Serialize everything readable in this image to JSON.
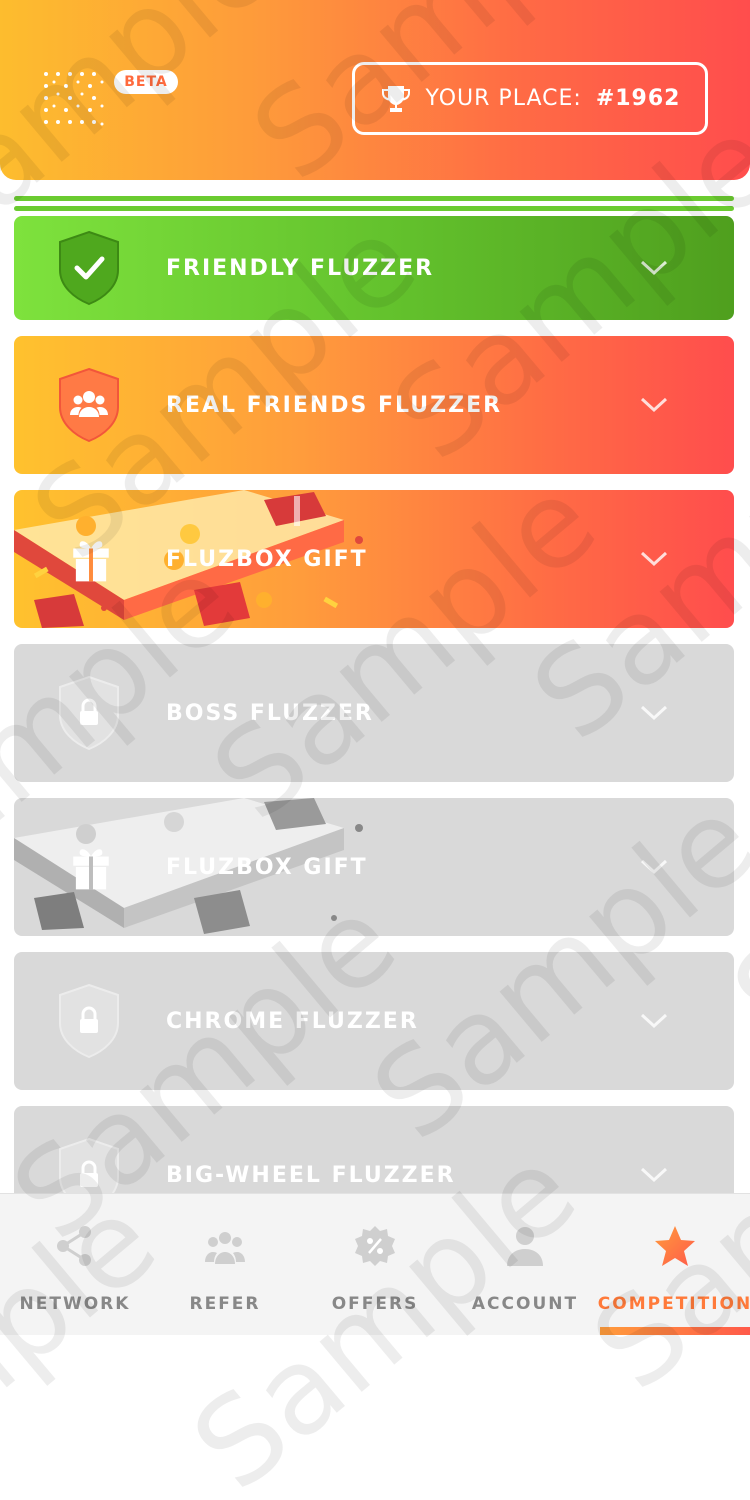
{
  "header": {
    "beta_label": "BETA",
    "place_label": "YOUR PLACE:",
    "place_value": "#1962"
  },
  "levels": [
    {
      "title": "FRIENDLY FLUZZER",
      "status": "completed",
      "icon": "check-shield-icon"
    },
    {
      "title": "REAL FRIENDS FLUZZER",
      "status": "active",
      "icon": "friends-shield-icon"
    },
    {
      "title": "FLUZBOX GIFT",
      "status": "unlocked-gift",
      "icon": "gift-icon"
    },
    {
      "title": "BOSS FLUZZER",
      "status": "locked",
      "icon": "lock-shield-icon"
    },
    {
      "title": "FLUZBOX GIFT",
      "status": "locked-gift",
      "icon": "gift-icon"
    },
    {
      "title": "CHROME FLUZZER",
      "status": "locked",
      "icon": "lock-shield-icon"
    },
    {
      "title": "BIG-WHEEL FLUZZER",
      "status": "locked",
      "icon": "lock-shield-icon"
    }
  ],
  "watermark_text": "Sample",
  "tabs": [
    {
      "label": "NETWORK",
      "icon": "share-icon"
    },
    {
      "label": "REFER",
      "icon": "group-icon"
    },
    {
      "label": "OFFERS",
      "icon": "percent-badge-icon"
    },
    {
      "label": "ACCOUNT",
      "icon": "person-icon"
    },
    {
      "label": "COMPETITION",
      "icon": "star-icon",
      "active": true
    }
  ],
  "colors": {
    "accent_orange": "#ff7a3a",
    "green": "#62c02c",
    "locked_grey": "#d9d9d9"
  }
}
